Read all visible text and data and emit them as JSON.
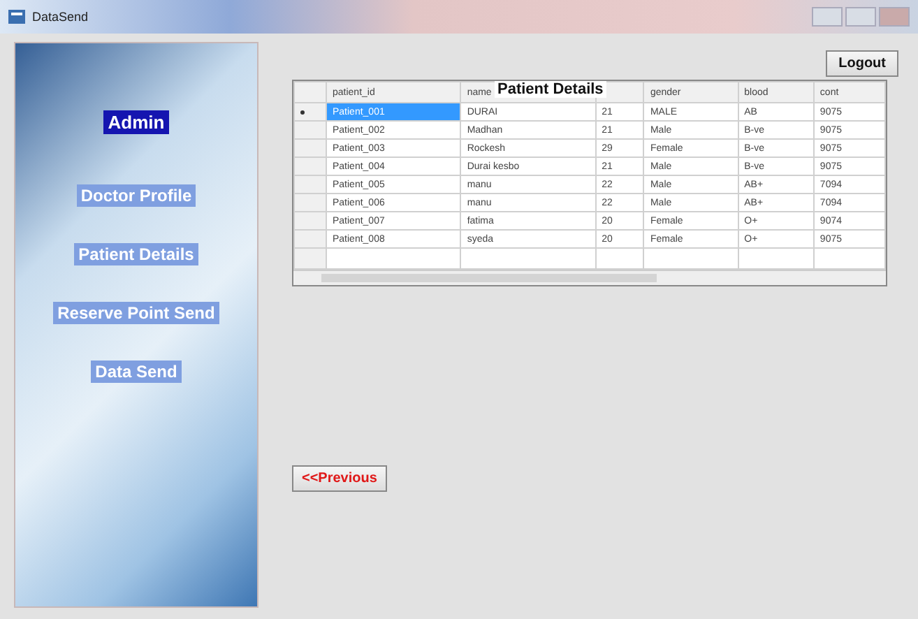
{
  "window": {
    "title": "DataSend"
  },
  "sidebar": {
    "items": [
      {
        "label": "Admin",
        "selected": true
      },
      {
        "label": "Doctor Profile",
        "selected": false
      },
      {
        "label": "Patient Details",
        "selected": false
      },
      {
        "label": "Reserve Point Send",
        "selected": false
      },
      {
        "label": "Data Send",
        "selected": false
      }
    ]
  },
  "logout_button": "Logout",
  "grid_title": "Patient Details",
  "table": {
    "columns": [
      "patient_id",
      "name",
      "",
      "gender",
      "blood",
      "cont"
    ],
    "rows": [
      {
        "cells": [
          "Patient_001",
          "DURAI",
          "21",
          "MALE",
          "AB",
          "9075"
        ],
        "selected": true
      },
      {
        "cells": [
          "Patient_002",
          "Madhan",
          "21",
          "Male",
          "B-ve",
          "9075"
        ],
        "selected": false
      },
      {
        "cells": [
          "Patient_003",
          "Rockesh",
          "29",
          "Female",
          "B-ve",
          "9075"
        ],
        "selected": false
      },
      {
        "cells": [
          "Patient_004",
          "Durai kesbo",
          "21",
          "Male",
          "B-ve",
          "9075"
        ],
        "selected": false
      },
      {
        "cells": [
          "Patient_005",
          "manu",
          "22",
          "Male",
          "AB+",
          "7094"
        ],
        "selected": false
      },
      {
        "cells": [
          "Patient_006",
          "manu",
          "22",
          "Male",
          "AB+",
          "7094"
        ],
        "selected": false
      },
      {
        "cells": [
          "Patient_007",
          "fatima",
          "20",
          "Female",
          "O+",
          "9074"
        ],
        "selected": false
      },
      {
        "cells": [
          "Patient_008",
          "syeda",
          "20",
          "Female",
          "O+",
          "9075"
        ],
        "selected": false
      }
    ]
  },
  "previous_button": "<<Previous"
}
